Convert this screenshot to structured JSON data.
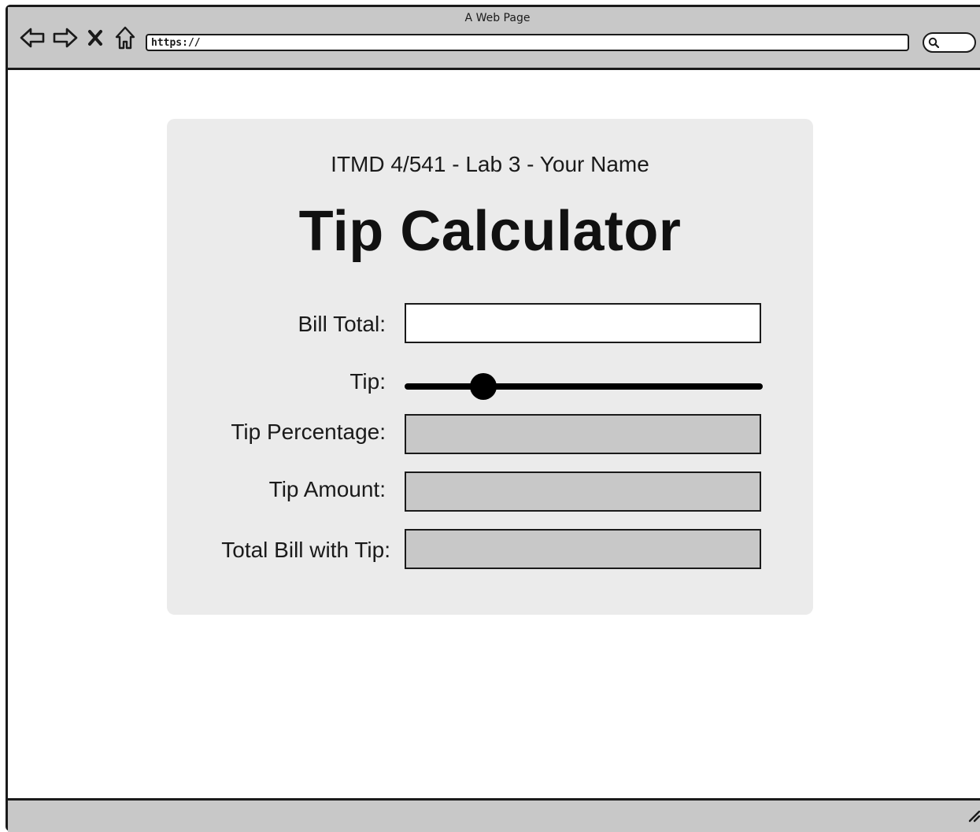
{
  "browser": {
    "window_title": "A Web Page",
    "url": "https://",
    "icons": {
      "back": "back-arrow-icon",
      "forward": "forward-arrow-icon",
      "stop": "close-icon",
      "home": "home-icon",
      "search": "search-icon",
      "resize": "resize-grip-icon"
    }
  },
  "card": {
    "subtitle": "ITMD 4/541 - Lab 3 - Your Name",
    "title": "Tip Calculator"
  },
  "form": {
    "bill_total": {
      "label": "Bill Total:",
      "value": ""
    },
    "tip": {
      "label": "Tip:",
      "slider_fraction": 0.22
    },
    "tip_percentage": {
      "label": "Tip Percentage:",
      "value": ""
    },
    "tip_amount": {
      "label": "Tip Amount:",
      "value": ""
    },
    "total_with_tip": {
      "label": "Total Bill with Tip:",
      "value": ""
    }
  },
  "colors": {
    "chrome": "#c8c8c8",
    "card": "#ebebeb",
    "readonly_field": "#c8c8c8",
    "editable_field": "#ffffff",
    "ink": "#1a1a1a"
  }
}
